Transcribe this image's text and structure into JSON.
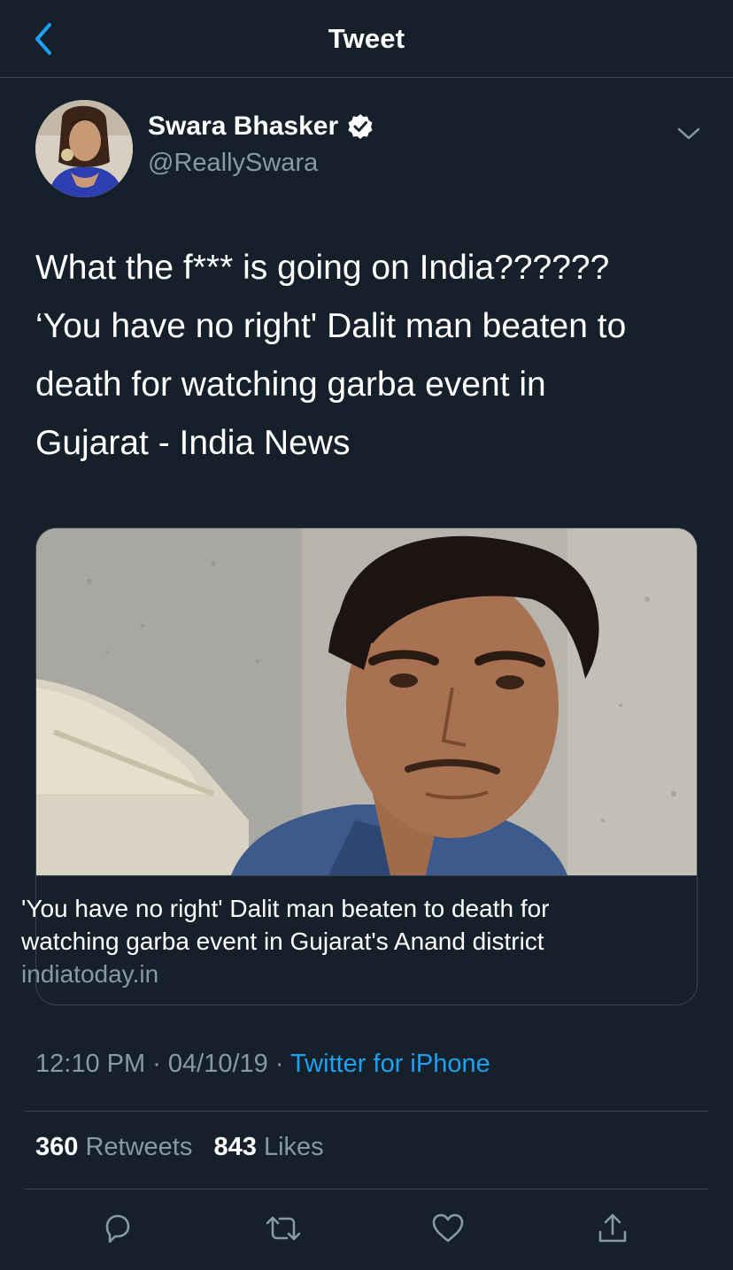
{
  "header": {
    "title": "Tweet",
    "back_icon": "chevron-left-icon",
    "accent_color": "#1da1f2"
  },
  "author": {
    "name": "Swara Bhasker",
    "handle": "@ReallySwara",
    "verified_icon": "verified-badge-icon",
    "menu_icon": "chevron-down-icon"
  },
  "tweet": {
    "lines": [
      "What the f*** is going on India??????",
      "‘You have no right' Dalit man beaten to",
      "death for watching garba event in",
      "Gujarat - India News"
    ]
  },
  "card": {
    "title_lines": [
      "'You have no right' Dalit man beaten to death for",
      "watching garba event in Gujarat's Anand district"
    ],
    "domain": "indiatoday.in"
  },
  "meta": {
    "time": "12:10 PM",
    "separator": " · ",
    "date": "04/10/19",
    "separator2": " · ",
    "source": "Twitter for iPhone"
  },
  "stats": {
    "retweets_count": "360",
    "retweets_label": "Retweets",
    "likes_count": "843",
    "likes_label": "Likes"
  },
  "actions": [
    "reply-icon",
    "retweet-icon",
    "like-icon",
    "share-icon"
  ],
  "colors": {
    "background": "#15202b",
    "secondary_text": "#8899a6",
    "border": "#38444d",
    "link": "#1da1f2"
  }
}
